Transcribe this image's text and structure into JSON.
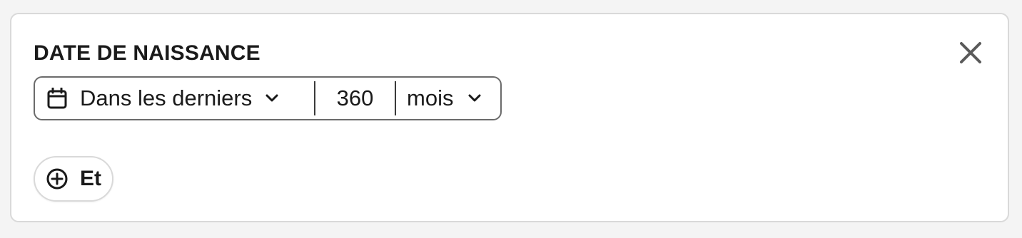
{
  "filter_card": {
    "title": "DATE DE NAISSANCE",
    "close_icon": "close-icon",
    "condition": {
      "operator_icon": "calendar-icon",
      "operator_label": "Dans les derniers",
      "value": "360",
      "unit_label": "mois"
    },
    "and_button": {
      "icon": "plus-circle-icon",
      "label": "Et"
    }
  },
  "colors": {
    "background": "#f4f4f4",
    "card_border": "#d9d9d9",
    "text": "#1a1a1a",
    "input_border": "#6b6b6b",
    "close_icon": "#5a5a5a"
  }
}
